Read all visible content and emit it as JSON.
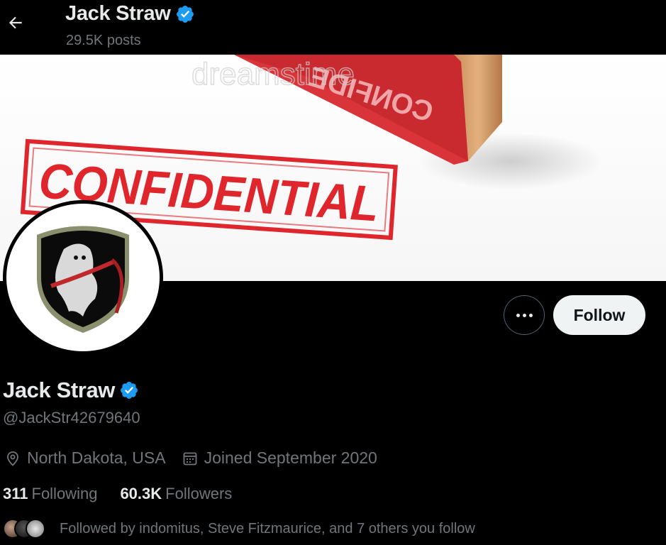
{
  "header": {
    "title": "Jack Straw",
    "posts": "29.5K posts",
    "back_icon": "arrow-left-icon"
  },
  "banner": {
    "stamp_text": "CONFIDENTIAL",
    "stamp_mirrored_text": "CONFIDE",
    "watermark": "dreamstime",
    "stamp_color": "#e0262d"
  },
  "profile": {
    "name": "Jack Straw",
    "handle": "@JackStr42679640",
    "location": "North Dakota, USA",
    "joined": "Joined September 2020",
    "following_count": "311",
    "following_label": "Following",
    "followers_count": "60.3K",
    "followers_label": "Followers",
    "followed_by": "Followed by indomitus, Steve Fitzmaurice, and 7 others you follow",
    "verified_color": "#1d9bf0"
  },
  "actions": {
    "follow_label": "Follow",
    "more_icon": "more-dots-icon"
  },
  "icons": {
    "location": "location-pin-icon",
    "calendar": "calendar-icon",
    "verified": "verified-badge-icon"
  }
}
